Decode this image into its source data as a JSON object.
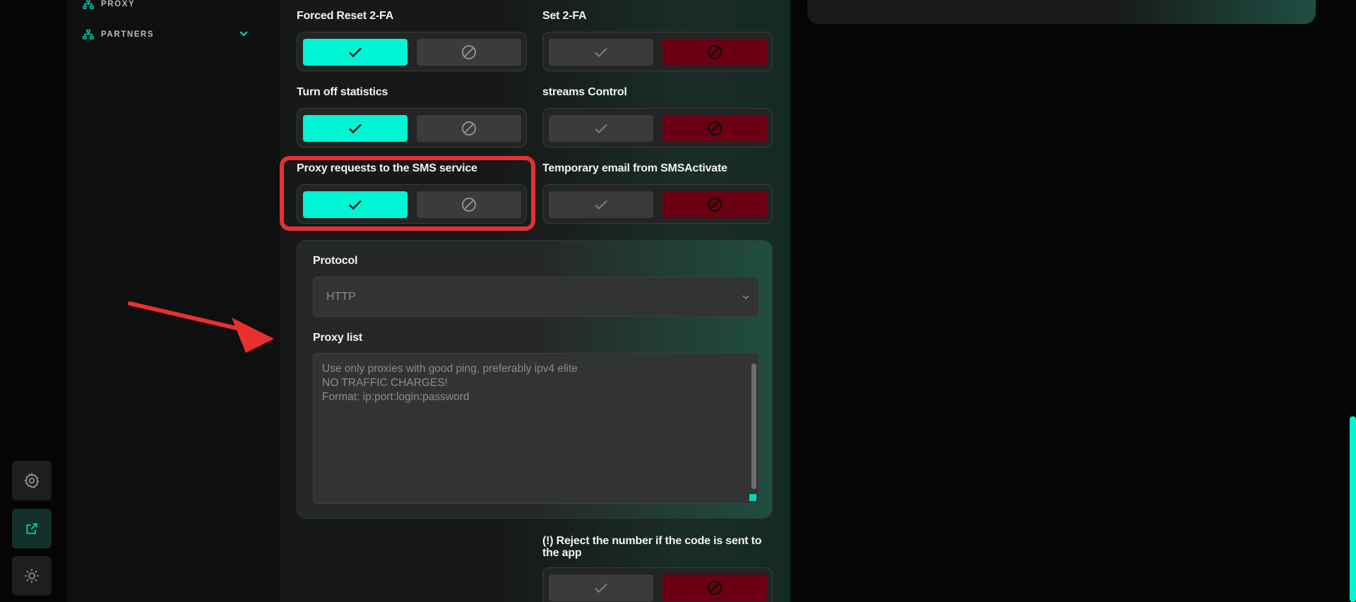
{
  "rail": {
    "items": [
      {
        "icon": "gear-icon"
      },
      {
        "icon": "external-link-icon"
      },
      {
        "icon": "sun-icon"
      }
    ]
  },
  "sidebar": {
    "items": [
      {
        "label": "PROXY",
        "icon": "network-icon"
      },
      {
        "label": "PARTNERS",
        "icon": "network-icon"
      }
    ]
  },
  "settings": {
    "forced_reset_2fa": {
      "label": "Forced Reset 2-FA",
      "state": "on"
    },
    "set_2fa": {
      "label": "Set 2-FA",
      "state": "off"
    },
    "turn_off_statistics": {
      "label": "Turn off statistics",
      "state": "on"
    },
    "streams_control": {
      "label": "streams Control",
      "state": "off"
    },
    "proxy_requests_sms": {
      "label": "Proxy requests to the SMS service",
      "state": "on"
    },
    "temporary_email": {
      "label": "Temporary email from SMSActivate",
      "state": "off"
    },
    "reject_number": {
      "label_line1": "(!) Reject the number if the code is sent to",
      "label_line2": "the app",
      "state": "off"
    }
  },
  "proxy": {
    "protocol_label": "Protocol",
    "protocol_value": "HTTP",
    "list_label": "Proxy list",
    "list_placeholder": [
      "Use only proxies with good ping, preferably ipv4 elite",
      "NO TRAFFIC CHARGES!",
      "Format: ip:port:login:password"
    ]
  },
  "colors": {
    "accent": "#00f5d4",
    "danger": "#6b0014",
    "highlight": "#e8302f"
  }
}
